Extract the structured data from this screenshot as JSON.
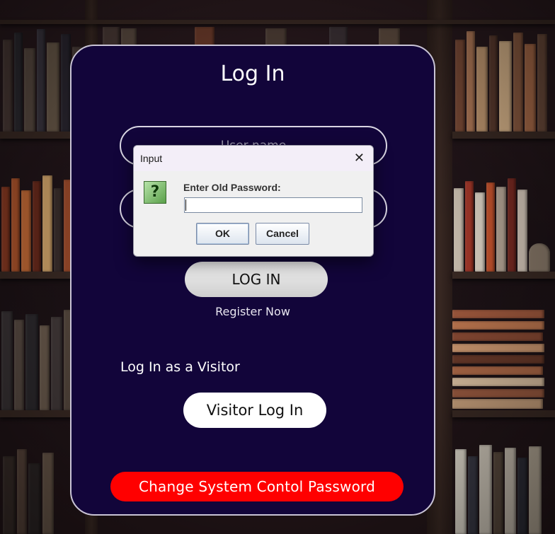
{
  "page": {
    "title": "Log In",
    "username_placeholder": "User name",
    "password_placeholder": "",
    "login_button": "LOG IN",
    "register_link": "Register Now",
    "visitor_label": "Log In as a Visitor",
    "visitor_button": "Visitor Log In",
    "change_password_button": "Change System Contol Password"
  },
  "dialog": {
    "title": "Input",
    "close_icon": "close-icon",
    "question_icon_glyph": "?",
    "prompt": "Enter Old Password:",
    "input_value": "",
    "ok_label": "OK",
    "cancel_label": "Cancel"
  },
  "colors": {
    "card_bg": "#12053a",
    "accent_red": "#ff0000",
    "dialog_bg": "#f0f0f0"
  }
}
